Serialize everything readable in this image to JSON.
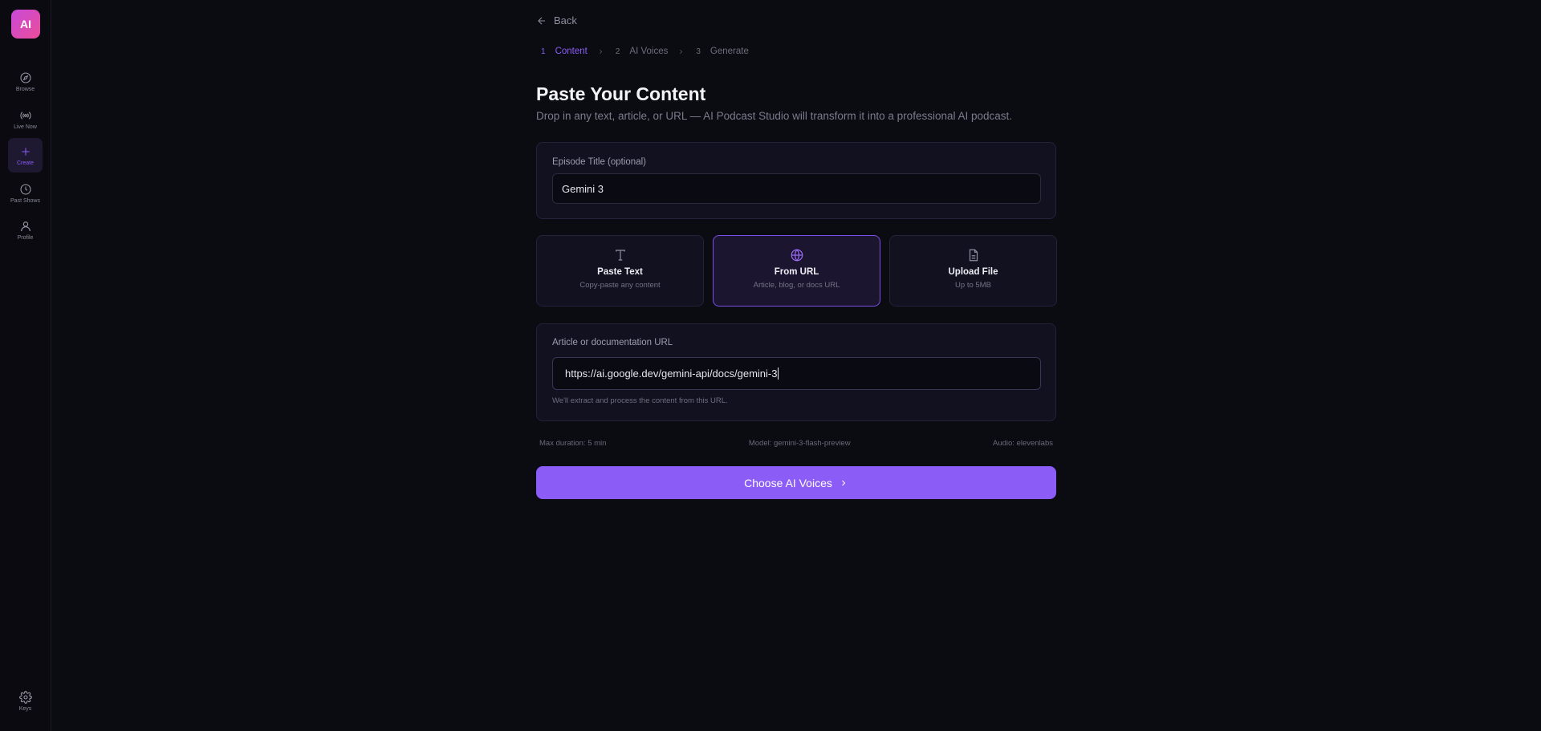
{
  "app": {
    "logo_text": "AI"
  },
  "sidebar": {
    "items": [
      {
        "label": "Browse",
        "icon": "compass-icon"
      },
      {
        "label": "Live Now",
        "icon": "broadcast-icon"
      },
      {
        "label": "Create",
        "icon": "plus-icon",
        "active": true
      },
      {
        "label": "Past Shows",
        "icon": "clock-icon"
      },
      {
        "label": "Profile",
        "icon": "user-icon"
      }
    ],
    "footer": {
      "label": "Keys",
      "icon": "gear-icon"
    }
  },
  "header": {
    "back_label": "Back"
  },
  "steps": [
    {
      "num": "1",
      "label": "Content",
      "active": true
    },
    {
      "num": "2",
      "label": "AI Voices"
    },
    {
      "num": "3",
      "label": "Generate"
    }
  ],
  "page": {
    "title": "Paste Your Content",
    "subtitle": "Drop in any text, article, or URL — AI Podcast Studio will transform it into a professional AI podcast."
  },
  "episode": {
    "label": "Episode Title (optional)",
    "value": "Gemini 3"
  },
  "source_options": [
    {
      "title": "Paste Text",
      "subtitle": "Copy-paste any content",
      "icon": "text-icon"
    },
    {
      "title": "From URL",
      "subtitle": "Article, blog, or docs URL",
      "icon": "globe-icon",
      "selected": true
    },
    {
      "title": "Upload File",
      "subtitle": "Up to 5MB",
      "icon": "file-icon"
    }
  ],
  "url_field": {
    "label": "Article or documentation URL",
    "value": "https://ai.google.dev/gemini-api/docs/gemini-3",
    "hint": "We'll extract and process the content from this URL."
  },
  "meta": {
    "duration": "Max duration: 5 min",
    "model": "Model: gemini-3-flash-preview",
    "audio": "Audio: elevenlabs"
  },
  "cta": {
    "label": "Choose AI Voices"
  },
  "colors": {
    "accent": "#8b5cf6",
    "background": "#0b0b12",
    "card": "#111120"
  }
}
